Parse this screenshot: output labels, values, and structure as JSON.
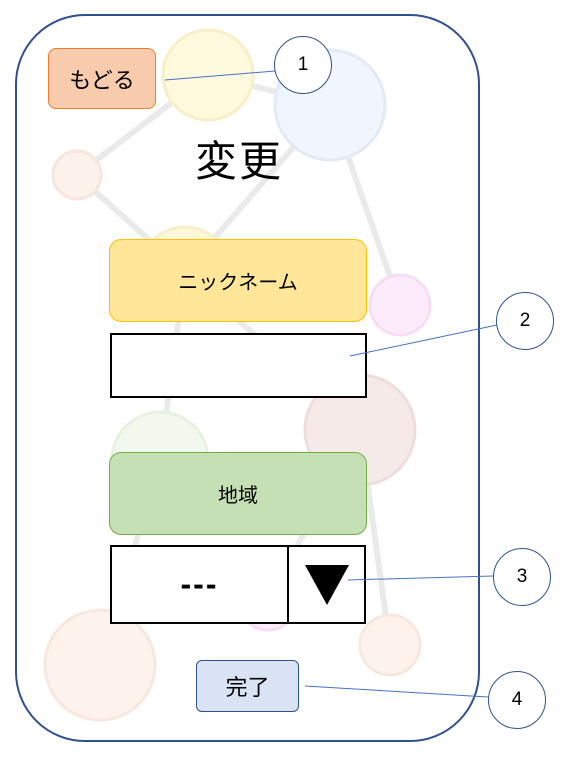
{
  "screen": {
    "back_button": "もどる",
    "title": "変更",
    "nickname_label": "ニックネーム",
    "nickname_input": {
      "value": ""
    },
    "region_label": "地域",
    "region_select": {
      "selected": "---"
    },
    "done_button": "完了"
  },
  "annotations": [
    "1",
    "2",
    "3",
    "4"
  ],
  "icons": {
    "region_select_arrow": "triangle-down-icon"
  },
  "colors": {
    "frame_border": "#2F528F",
    "back_button_fill": "#F8CBAD",
    "back_button_border": "#ED7D31",
    "nickname_label_fill": "#FFE699",
    "nickname_label_border": "#FFC000",
    "region_label_fill": "#C5E0B4",
    "region_label_border": "#70AD47",
    "done_button_fill": "#DAE3F3",
    "done_button_border": "#2F528F",
    "callout_border": "#2F528F",
    "callout_line": "#4472C4"
  }
}
